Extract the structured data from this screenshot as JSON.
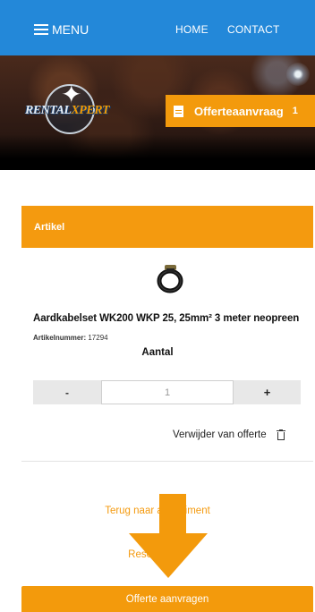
{
  "nav": {
    "menu_label": "MENU",
    "links": [
      {
        "label": "HOME"
      },
      {
        "label": "CONTACT"
      }
    ]
  },
  "brand": {
    "logo_text_part1": "RENTAL",
    "logo_text_part2": "XPERT",
    "primary_color": "#2388d9",
    "accent_color": "#f39a0c"
  },
  "quote_tab": {
    "label": "Offerteaanvraag",
    "count": "1",
    "icon": "document-icon"
  },
  "article_panel": {
    "header": "Artikel",
    "product": {
      "image_icon": "ground-cable-icon",
      "name": "Aardkabelset WK200 WKP 25, 25mm² 3 meter neopreen",
      "sku_label": "Artikelnummer:",
      "sku_value": "17294"
    },
    "quantity": {
      "label": "Aantal",
      "minus": "-",
      "value": "1",
      "plus": "+"
    },
    "remove_label": "Verwijder van offerte",
    "remove_icon": "trash-icon"
  },
  "links": {
    "back": "Terug naar assortiment",
    "reset": "Reset offerte"
  },
  "cta": {
    "label": "Offerte aanvragen"
  }
}
